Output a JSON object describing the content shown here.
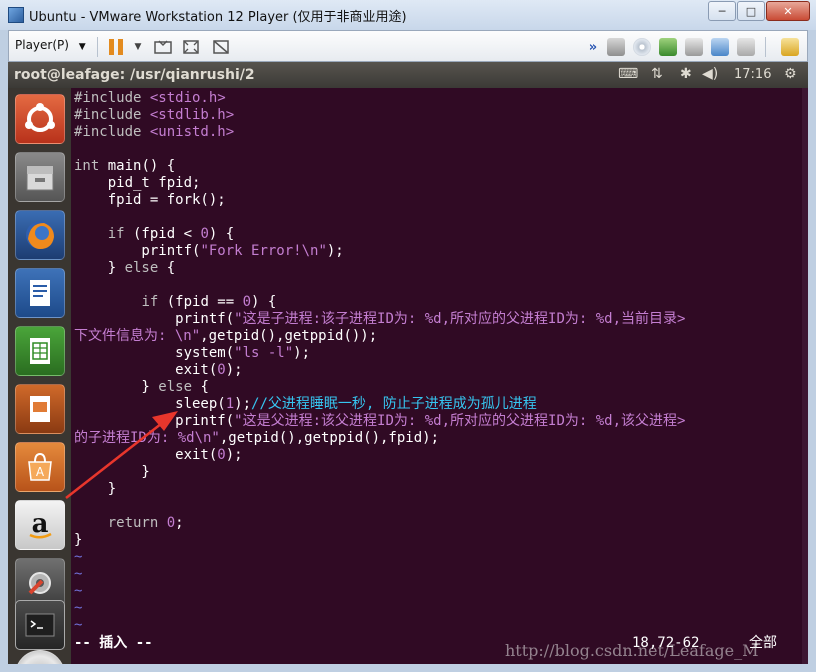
{
  "window": {
    "title": "Ubuntu - VMware Workstation 12 Player (仅用于非商业用途)",
    "minimize": "─",
    "maximize": "□",
    "close": "✕"
  },
  "toolbar": {
    "player_menu": "Player(P)",
    "icons": [
      "pause-icon",
      "send-keys-icon",
      "fit-window-icon",
      "unity-icon",
      "more-icon",
      "hdd-icon",
      "cd-icon",
      "network-icon",
      "printer-icon",
      "sound-icon",
      "camera-icon",
      "message-icon"
    ]
  },
  "panel": {
    "title": "root@leafage: /usr/qianrushi/2",
    "keyboard": "⌨",
    "network": "⇅",
    "bluetooth": "✱",
    "volume": "◀)",
    "time": "17:16",
    "settings": "⚙"
  },
  "launcher": {
    "apps": [
      "ubuntu-dash-icon",
      "files-icon",
      "firefox-icon",
      "writer-icon",
      "calc-icon",
      "impress-icon",
      "software-center-icon",
      "amazon-icon",
      "settings-icon",
      "terminal-icon",
      "disc-icon"
    ]
  },
  "code": [
    {
      "parts": [
        {
          "t": "#include ",
          "c": "kw"
        },
        {
          "t": "<stdio.h>",
          "c": "str"
        }
      ]
    },
    {
      "parts": [
        {
          "t": "#include ",
          "c": "kw"
        },
        {
          "t": "<stdlib.h>",
          "c": "str"
        }
      ]
    },
    {
      "parts": [
        {
          "t": "#include ",
          "c": "kw"
        },
        {
          "t": "<unistd.h>",
          "c": "str"
        }
      ]
    },
    {
      "parts": [
        {
          "t": "",
          "c": ""
        }
      ]
    },
    {
      "parts": [
        {
          "t": "int",
          "c": "kw"
        },
        {
          "t": " main() {",
          "c": ""
        }
      ]
    },
    {
      "parts": [
        {
          "t": "    pid_t fpid;",
          "c": ""
        }
      ]
    },
    {
      "parts": [
        {
          "t": "    fpid = fork();",
          "c": ""
        }
      ]
    },
    {
      "parts": [
        {
          "t": "",
          "c": ""
        }
      ]
    },
    {
      "parts": [
        {
          "t": "    ",
          "c": ""
        },
        {
          "t": "if",
          "c": "kw"
        },
        {
          "t": " (fpid < ",
          "c": ""
        },
        {
          "t": "0",
          "c": "num"
        },
        {
          "t": ") {",
          "c": ""
        }
      ]
    },
    {
      "parts": [
        {
          "t": "        printf(",
          "c": ""
        },
        {
          "t": "\"Fork Error!\\n\"",
          "c": "str"
        },
        {
          "t": ");",
          "c": ""
        }
      ]
    },
    {
      "parts": [
        {
          "t": "    } ",
          "c": ""
        },
        {
          "t": "else",
          "c": "kw"
        },
        {
          "t": " {",
          "c": ""
        }
      ]
    },
    {
      "parts": [
        {
          "t": "",
          "c": ""
        }
      ]
    },
    {
      "parts": [
        {
          "t": "        ",
          "c": ""
        },
        {
          "t": "if",
          "c": "kw"
        },
        {
          "t": " (fpid == ",
          "c": ""
        },
        {
          "t": "0",
          "c": "num"
        },
        {
          "t": ") {",
          "c": ""
        }
      ]
    },
    {
      "parts": [
        {
          "t": "            printf(",
          "c": ""
        },
        {
          "t": "\"这是子进程:该子进程ID为: %d,所对应的父进程ID为: %d,当前目录>",
          "c": "str"
        }
      ]
    },
    {
      "parts": [
        {
          "t": "下文件信息为: \\n\"",
          "c": "str"
        },
        {
          "t": ",getpid(),getppid());",
          "c": ""
        }
      ]
    },
    {
      "parts": [
        {
          "t": "            system(",
          "c": ""
        },
        {
          "t": "\"ls -l\"",
          "c": "str"
        },
        {
          "t": ");",
          "c": ""
        }
      ]
    },
    {
      "parts": [
        {
          "t": "            exit(",
          "c": ""
        },
        {
          "t": "0",
          "c": "num"
        },
        {
          "t": ");",
          "c": ""
        }
      ]
    },
    {
      "parts": [
        {
          "t": "        } ",
          "c": ""
        },
        {
          "t": "else",
          "c": "kw"
        },
        {
          "t": " {",
          "c": ""
        }
      ]
    },
    {
      "parts": [
        {
          "t": "            sleep(",
          "c": ""
        },
        {
          "t": "1",
          "c": "num"
        },
        {
          "t": ");",
          "c": ""
        },
        {
          "t": "//父进程睡眠一秒, 防止子进程成为孤儿进程",
          "c": "cm"
        }
      ]
    },
    {
      "parts": [
        {
          "t": "            printf(",
          "c": ""
        },
        {
          "t": "\"这是父进程:该父进程ID为: %d,所对应的父进程ID为: %d,该父进程>",
          "c": "str"
        }
      ]
    },
    {
      "parts": [
        {
          "t": "的子进程ID为: %d\\n\"",
          "c": "str"
        },
        {
          "t": ",getpid(),getppid(),fpid);",
          "c": ""
        }
      ]
    },
    {
      "parts": [
        {
          "t": "            exit(",
          "c": ""
        },
        {
          "t": "0",
          "c": "num"
        },
        {
          "t": ");",
          "c": ""
        }
      ]
    },
    {
      "parts": [
        {
          "t": "        }",
          "c": ""
        }
      ]
    },
    {
      "parts": [
        {
          "t": "    }",
          "c": ""
        }
      ]
    },
    {
      "parts": [
        {
          "t": "",
          "c": ""
        }
      ]
    },
    {
      "parts": [
        {
          "t": "    ",
          "c": ""
        },
        {
          "t": "return",
          "c": "kw"
        },
        {
          "t": " ",
          "c": ""
        },
        {
          "t": "0",
          "c": "num"
        },
        {
          "t": ";",
          "c": ""
        }
      ]
    },
    {
      "parts": [
        {
          "t": "}",
          "c": ""
        }
      ]
    },
    {
      "parts": [
        {
          "t": "~",
          "c": "tilde"
        }
      ]
    },
    {
      "parts": [
        {
          "t": "~",
          "c": "tilde"
        }
      ]
    },
    {
      "parts": [
        {
          "t": "~",
          "c": "tilde"
        }
      ]
    },
    {
      "parts": [
        {
          "t": "~",
          "c": "tilde"
        }
      ]
    },
    {
      "parts": [
        {
          "t": "~",
          "c": "tilde"
        }
      ]
    }
  ],
  "status": {
    "mode": "-- 插入 --",
    "position": "18,72-62",
    "scroll": "全部"
  },
  "watermark": "http://blog.csdn.net/Leafage_M",
  "colors": {
    "terminal_bg": "#300a24",
    "string": "#c47ed1",
    "comment": "#36c5f0",
    "arrow": "#e8362c"
  }
}
